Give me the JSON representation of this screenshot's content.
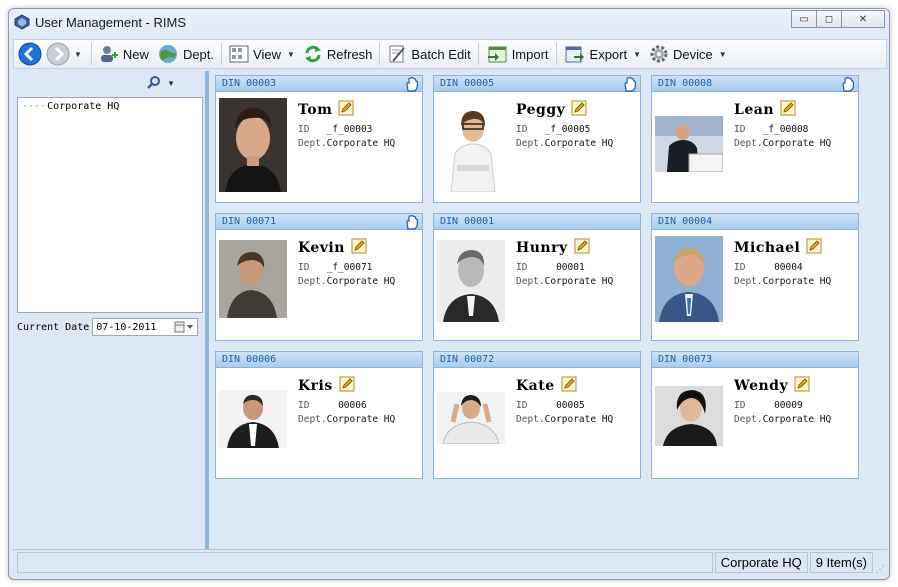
{
  "window": {
    "title": "User Management - RIMS",
    "min_glyph": "▭",
    "max_glyph": "◻",
    "close_glyph": "✕"
  },
  "toolbar": {
    "new_label": "New",
    "dept_label": "Dept.",
    "view_label": "View",
    "refresh_label": "Refresh",
    "batch_edit_label": "Batch Edit",
    "import_label": "Import",
    "export_label": "Export",
    "device_label": "Device"
  },
  "tree": {
    "items": [
      {
        "label": "Corporate HQ"
      }
    ]
  },
  "date": {
    "label": "Current Date",
    "value": "07-10-2011"
  },
  "labels": {
    "id": "ID",
    "dept": "Dept."
  },
  "cards": [
    {
      "din": "DIN 00003",
      "name": "Tom",
      "id": "_f_00003",
      "dept": "Corporate HQ",
      "hand": true
    },
    {
      "din": "DIN 00005",
      "name": "Peggy",
      "id": "_f_00005",
      "dept": "Corporate HQ",
      "hand": true
    },
    {
      "din": "DIN 00008",
      "name": "Lean",
      "id": "_f_00008",
      "dept": "Corporate HQ",
      "hand": true
    },
    {
      "din": "DIN 00071",
      "name": "Kevin",
      "id": "_f_00071",
      "dept": "Corporate HQ",
      "hand": true
    },
    {
      "din": "DIN 00001",
      "name": "Hunry",
      "id": "00001",
      "dept": "Corporate HQ",
      "hand": false
    },
    {
      "din": "DIN 00004",
      "name": "Michael",
      "id": "00004",
      "dept": "Corporate HQ",
      "hand": false
    },
    {
      "din": "DIN 00006",
      "name": "Kris",
      "id": "00006",
      "dept": "Corporate HQ",
      "hand": false
    },
    {
      "din": "DIN 00072",
      "name": "Kate",
      "id": "00005",
      "dept": "Corporate HQ",
      "hand": false
    },
    {
      "din": "DIN 00073",
      "name": "Wendy",
      "id": "00009",
      "dept": "Corporate HQ",
      "hand": false
    }
  ],
  "status": {
    "department": "Corporate HQ",
    "count": "9 Item(s)"
  },
  "colors": {
    "accent": "#1f5f9e",
    "header": "#a9cbee",
    "splitter": "#8fb8df",
    "back_button": "#1e73d6"
  }
}
